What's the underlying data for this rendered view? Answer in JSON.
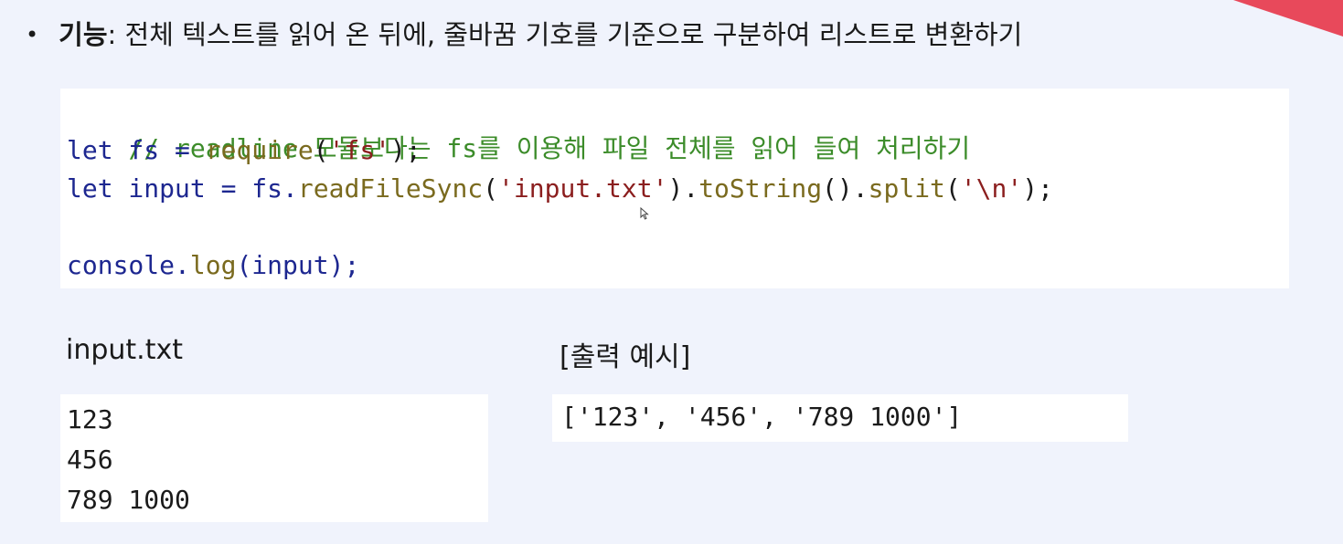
{
  "bullet": {
    "symbol": "•",
    "key": "기능",
    "text": ": 전체 텍스트를 읽어 온 뒤에, 줄바꿈 기호를 기준으로 구분하여 리스트로 변환하기"
  },
  "code": {
    "comment": "// readline 모듈보다는 fs를 이용해 파일 전체를 읽어 들여 처리하기",
    "line2": {
      "kw": "let",
      "var": " fs = ",
      "fn": "require",
      "open": "(",
      "str": "'fs'",
      "close": ");"
    },
    "line3": {
      "kw": "let",
      "var": " input = fs.",
      "fn1": "readFileSync",
      "open1": "(",
      "str1": "'input.txt'",
      "mid1": ").",
      "fn2": "toString",
      "mid2": "().",
      "fn3": "split",
      "open3": "(",
      "str3": "'\\n'",
      "close3": ");"
    },
    "line5": {
      "obj": "console.",
      "fn": "log",
      "rest": "(input);"
    }
  },
  "input_file": {
    "label": "input.txt",
    "lines": [
      "123",
      "456",
      "789 1000"
    ]
  },
  "output_example": {
    "label": "[출력 예시]",
    "value": "['123', '456', '789 1000']"
  },
  "colors": {
    "background": "#f0f3fc",
    "accent": "#e8495b",
    "comment": "#3c8c2a",
    "keyword": "#1d2790",
    "function": "#7a6a1e",
    "string": "#8b1e1e"
  },
  "icons": {
    "corner": "corner-triangle-decoration",
    "cursor": "mouse-cursor-icon"
  }
}
